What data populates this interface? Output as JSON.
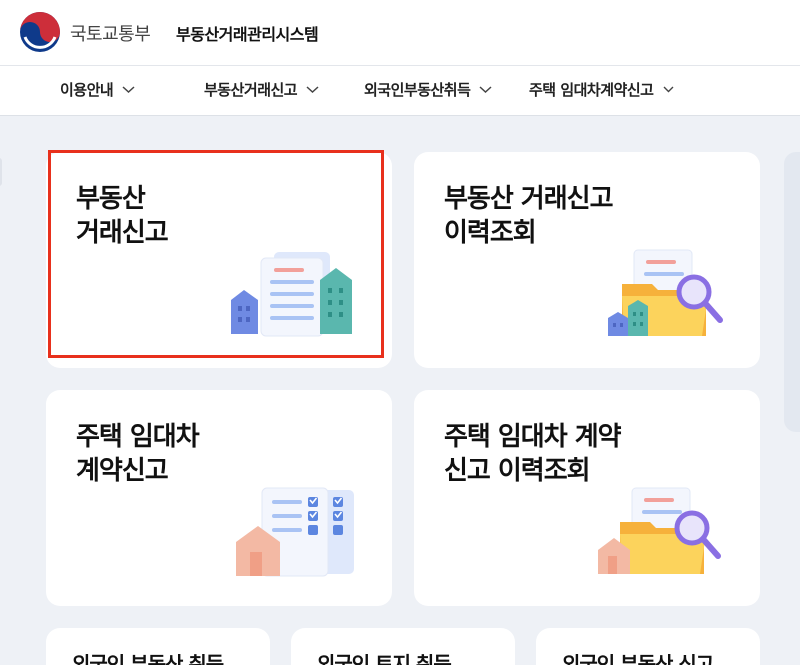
{
  "header": {
    "ministry": "국토교통부",
    "system_title": "부동산거래관리시스템"
  },
  "nav": [
    {
      "label": "이용안내"
    },
    {
      "label": "부동산거래신고"
    },
    {
      "label": "외국인부동산취득"
    },
    {
      "label": "주택 임대차계약신고"
    }
  ],
  "cards": [
    {
      "title": "부동산\n거래신고",
      "selected": true
    },
    {
      "title": "부동산 거래신고\n이력조회"
    },
    {
      "title": "주택 임대차\n계약신고"
    },
    {
      "title": "주택 임대차 계약\n신고 이력조회"
    }
  ],
  "small_cards": [
    {
      "title": "외국인 부동산 취득"
    },
    {
      "title": "외국인 토지 취득"
    },
    {
      "title": "외국인 부동산 신고"
    }
  ],
  "colors": {
    "selection_border": "#e8301c",
    "logo_red": "#cd2e3a",
    "logo_blue": "#0f3a8a"
  }
}
